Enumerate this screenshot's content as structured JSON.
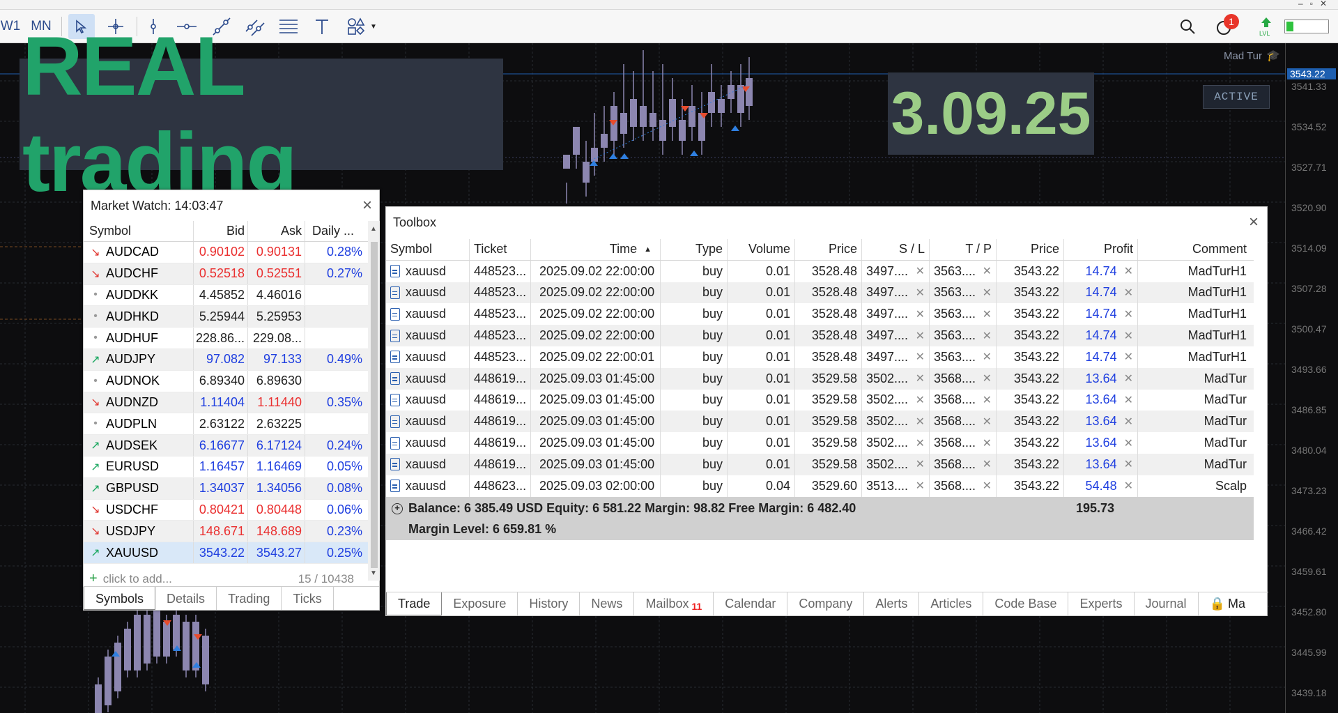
{
  "toolbar": {
    "timeframes": [
      "W1",
      "MN"
    ],
    "notification_count": "1"
  },
  "banner": {
    "text": "REAL trading"
  },
  "date_badge": {
    "text": "3.09.25"
  },
  "bot": {
    "name": "Mad Tur",
    "status": "ACTIVE"
  },
  "price_axis": {
    "current": "3543.22",
    "ticks": [
      "3541.33",
      "3534.52",
      "3527.71",
      "3520.90",
      "3514.09",
      "3507.28",
      "3500.47",
      "3493.66",
      "3486.85",
      "3480.04",
      "3473.23",
      "3466.42",
      "3459.61",
      "3452.80",
      "3445.99",
      "3439.18"
    ]
  },
  "market_watch": {
    "title": "Market Watch: 14:03:47",
    "columns": [
      "Symbol",
      "Bid",
      "Ask",
      "Daily ..."
    ],
    "rows": [
      {
        "dir": "down",
        "symbol": "AUDCAD",
        "bid": "0.90102",
        "ask": "0.90131",
        "daily": "0.28%",
        "color": "red"
      },
      {
        "dir": "down",
        "symbol": "AUDCHF",
        "bid": "0.52518",
        "ask": "0.52551",
        "daily": "0.27%",
        "color": "red"
      },
      {
        "dir": "flat",
        "symbol": "AUDDKK",
        "bid": "4.45852",
        "ask": "4.46016",
        "daily": "",
        "color": "blk"
      },
      {
        "dir": "flat",
        "symbol": "AUDHKD",
        "bid": "5.25944",
        "ask": "5.25953",
        "daily": "",
        "color": "blk"
      },
      {
        "dir": "flat",
        "symbol": "AUDHUF",
        "bid": "228.86...",
        "ask": "229.08...",
        "daily": "",
        "color": "blk"
      },
      {
        "dir": "up",
        "symbol": "AUDJPY",
        "bid": "97.082",
        "ask": "97.133",
        "daily": "0.49%",
        "color": "blue"
      },
      {
        "dir": "flat",
        "symbol": "AUDNOK",
        "bid": "6.89340",
        "ask": "6.89630",
        "daily": "",
        "color": "blk"
      },
      {
        "dir": "down",
        "symbol": "AUDNZD",
        "bid": "1.11404",
        "ask": "1.11440",
        "daily": "0.35%",
        "color": "split"
      },
      {
        "dir": "flat",
        "symbol": "AUDPLN",
        "bid": "2.63122",
        "ask": "2.63225",
        "daily": "",
        "color": "blk"
      },
      {
        "dir": "up",
        "symbol": "AUDSEK",
        "bid": "6.16677",
        "ask": "6.17124",
        "daily": "0.24%",
        "color": "blue"
      },
      {
        "dir": "up",
        "symbol": "EURUSD",
        "bid": "1.16457",
        "ask": "1.16469",
        "daily": "0.05%",
        "color": "blue"
      },
      {
        "dir": "up",
        "symbol": "GBPUSD",
        "bid": "1.34037",
        "ask": "1.34056",
        "daily": "0.08%",
        "color": "blue"
      },
      {
        "dir": "down",
        "symbol": "USDCHF",
        "bid": "0.80421",
        "ask": "0.80448",
        "daily": "0.06%",
        "color": "red"
      },
      {
        "dir": "down",
        "symbol": "USDJPY",
        "bid": "148.671",
        "ask": "148.689",
        "daily": "0.23%",
        "color": "red"
      },
      {
        "dir": "up",
        "symbol": "XAUUSD",
        "bid": "3543.22",
        "ask": "3543.27",
        "daily": "0.25%",
        "color": "blue"
      }
    ],
    "add_placeholder": "click to add...",
    "count": "15 / 10438",
    "tabs": [
      "Symbols",
      "Details",
      "Trading",
      "Ticks"
    ]
  },
  "toolbox": {
    "title": "Toolbox",
    "columns": [
      "Symbol",
      "Ticket",
      "Time",
      "Type",
      "Volume",
      "Price",
      "S / L",
      "T / P",
      "Price",
      "Profit",
      "Comment"
    ],
    "rows": [
      {
        "symbol": "xauusd",
        "ticket": "448523...",
        "time": "2025.09.02 22:00:00",
        "type": "buy",
        "volume": "0.01",
        "price": "3528.48",
        "sl": "3497....",
        "tp": "3563....",
        "cur": "3543.22",
        "profit": "14.74",
        "comment": "MadTurH1"
      },
      {
        "symbol": "xauusd",
        "ticket": "448523...",
        "time": "2025.09.02 22:00:00",
        "type": "buy",
        "volume": "0.01",
        "price": "3528.48",
        "sl": "3497....",
        "tp": "3563....",
        "cur": "3543.22",
        "profit": "14.74",
        "comment": "MadTurH1"
      },
      {
        "symbol": "xauusd",
        "ticket": "448523...",
        "time": "2025.09.02 22:00:00",
        "type": "buy",
        "volume": "0.01",
        "price": "3528.48",
        "sl": "3497....",
        "tp": "3563....",
        "cur": "3543.22",
        "profit": "14.74",
        "comment": "MadTurH1"
      },
      {
        "symbol": "xauusd",
        "ticket": "448523...",
        "time": "2025.09.02 22:00:00",
        "type": "buy",
        "volume": "0.01",
        "price": "3528.48",
        "sl": "3497....",
        "tp": "3563....",
        "cur": "3543.22",
        "profit": "14.74",
        "comment": "MadTurH1"
      },
      {
        "symbol": "xauusd",
        "ticket": "448523...",
        "time": "2025.09.02 22:00:01",
        "type": "buy",
        "volume": "0.01",
        "price": "3528.48",
        "sl": "3497....",
        "tp": "3563....",
        "cur": "3543.22",
        "profit": "14.74",
        "comment": "MadTurH1"
      },
      {
        "symbol": "xauusd",
        "ticket": "448619...",
        "time": "2025.09.03 01:45:00",
        "type": "buy",
        "volume": "0.01",
        "price": "3529.58",
        "sl": "3502....",
        "tp": "3568....",
        "cur": "3543.22",
        "profit": "13.64",
        "comment": "MadTur"
      },
      {
        "symbol": "xauusd",
        "ticket": "448619...",
        "time": "2025.09.03 01:45:00",
        "type": "buy",
        "volume": "0.01",
        "price": "3529.58",
        "sl": "3502....",
        "tp": "3568....",
        "cur": "3543.22",
        "profit": "13.64",
        "comment": "MadTur"
      },
      {
        "symbol": "xauusd",
        "ticket": "448619...",
        "time": "2025.09.03 01:45:00",
        "type": "buy",
        "volume": "0.01",
        "price": "3529.58",
        "sl": "3502....",
        "tp": "3568....",
        "cur": "3543.22",
        "profit": "13.64",
        "comment": "MadTur"
      },
      {
        "symbol": "xauusd",
        "ticket": "448619...",
        "time": "2025.09.03 01:45:00",
        "type": "buy",
        "volume": "0.01",
        "price": "3529.58",
        "sl": "3502....",
        "tp": "3568....",
        "cur": "3543.22",
        "profit": "13.64",
        "comment": "MadTur"
      },
      {
        "symbol": "xauusd",
        "ticket": "448619...",
        "time": "2025.09.03 01:45:00",
        "type": "buy",
        "volume": "0.01",
        "price": "3529.58",
        "sl": "3502....",
        "tp": "3568....",
        "cur": "3543.22",
        "profit": "13.64",
        "comment": "MadTur"
      },
      {
        "symbol": "xauusd",
        "ticket": "448623...",
        "time": "2025.09.03 02:00:00",
        "type": "buy",
        "volume": "0.04",
        "price": "3529.60",
        "sl": "3513....",
        "tp": "3568....",
        "cur": "3543.22",
        "profit": "54.48",
        "comment": "Scalp"
      }
    ],
    "summary_line": "Balance: 6 385.49 USD  Equity: 6 581.22  Margin: 98.82  Free Margin: 6 482.40",
    "summary_total": "195.73",
    "margin_level": "Margin Level: 6 659.81 %",
    "tabs": [
      "Trade",
      "Exposure",
      "History",
      "News",
      "Mailbox",
      "Calendar",
      "Company",
      "Alerts",
      "Articles",
      "Code Base",
      "Experts",
      "Journal",
      "Ma"
    ],
    "mailbox_count": "11"
  },
  "colors": {
    "accent_blue": "#1f3fe0",
    "red": "#ea2f2f",
    "green_banner": "#21a36a",
    "date_green": "#9ccd87"
  }
}
